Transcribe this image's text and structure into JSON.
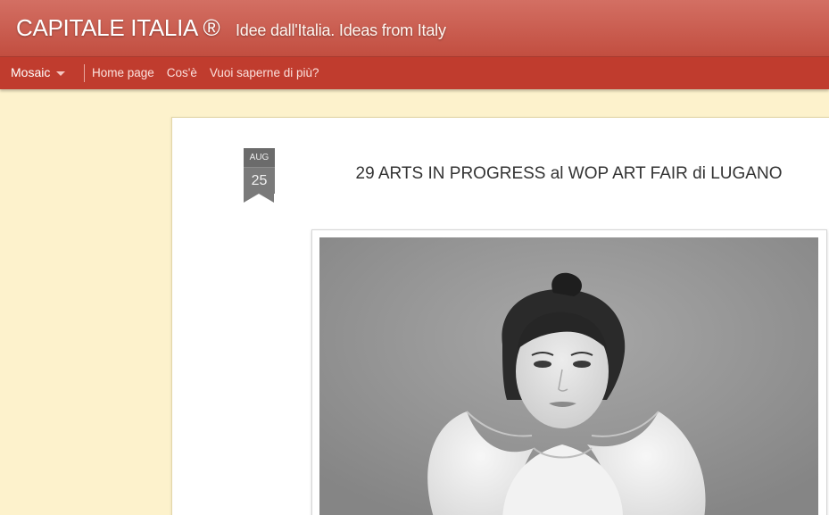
{
  "header": {
    "title": "CAPITALE ITALIA ®",
    "description": "Idee dall'Italia. Ideas from Italy"
  },
  "navbar": {
    "view_label": "Mosaic",
    "links": [
      "Home page",
      "Cos'è",
      "Vuoi saperne di più?"
    ]
  },
  "post": {
    "date_month": "AUG",
    "date_day": "25",
    "title": "29 ARTS IN PROGRESS al WOP ART FAIR di LUGANO"
  },
  "colors": {
    "header": "#c9584b",
    "navbar": "#c03c2e",
    "background": "#fdf2cc",
    "date_badge": "#7a7a7a"
  },
  "icons": {
    "view_dropdown": "caret-down-icon"
  }
}
